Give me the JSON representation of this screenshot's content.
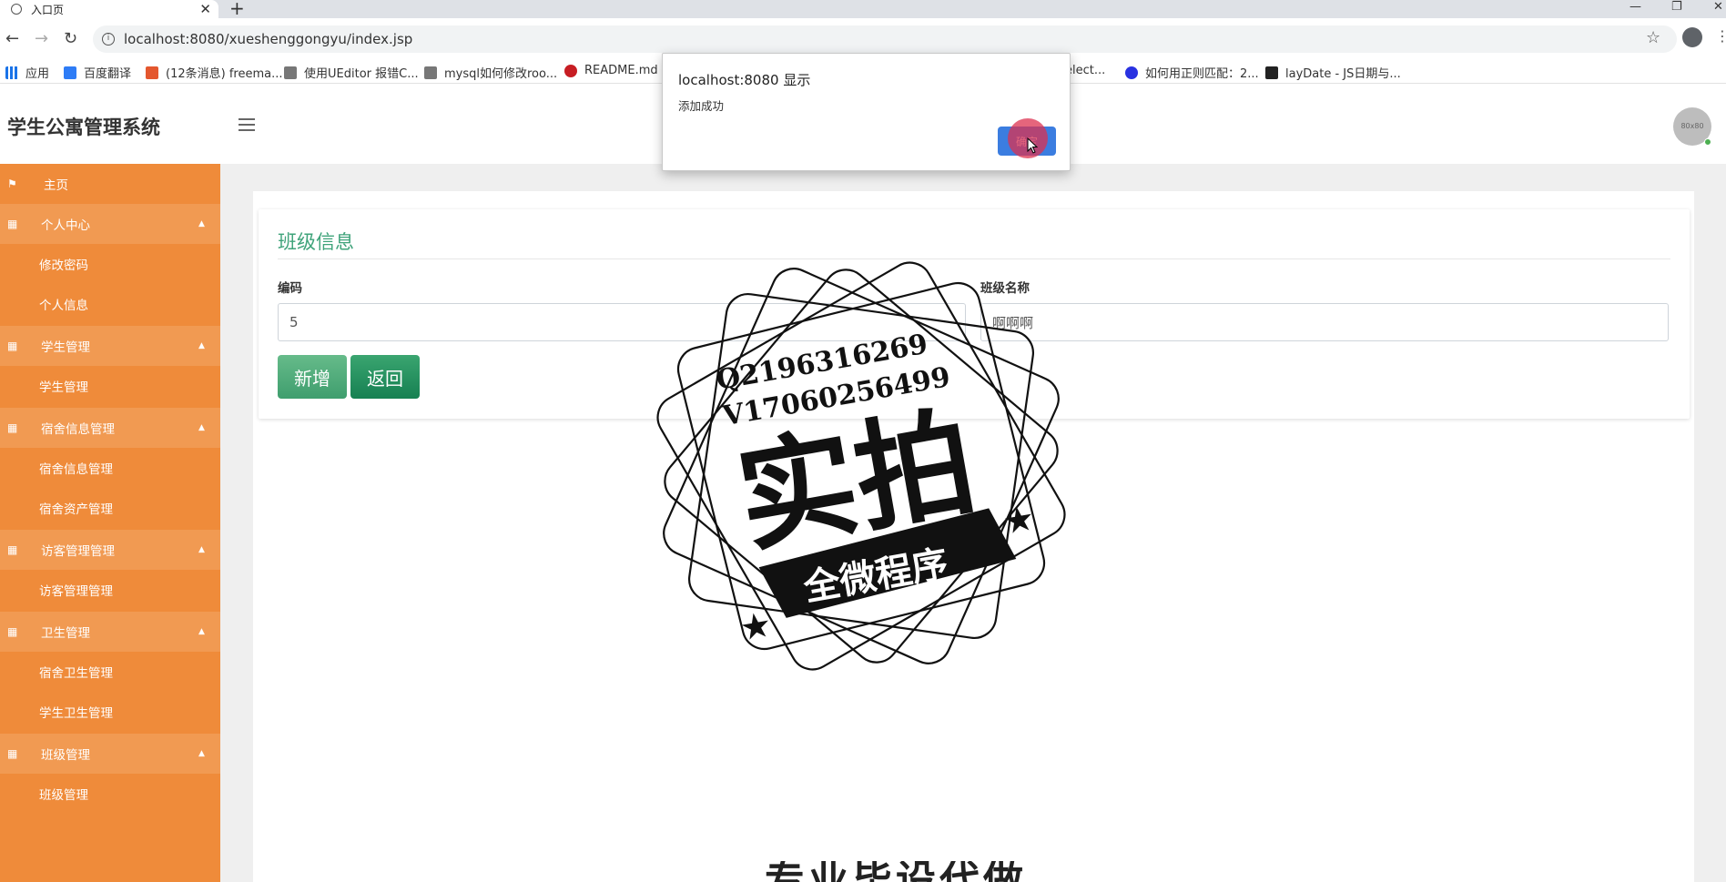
{
  "browser": {
    "tab_title": "入口页",
    "new_tab": "+",
    "url": "localhost:8080/xueshenggongyu/index.jsp",
    "bookmarks": [
      "应用",
      "百度翻译",
      "(12条消息) freema...",
      "使用UEditor 报错C...",
      "mysql如何修改roo...",
      "README.md ·",
      "elect...",
      "如何用正则匹配：2...",
      "layDate - JS日期与..."
    ]
  },
  "header": {
    "brand": "学生公寓管理系统",
    "avatar_text": "80x80"
  },
  "sidebar": {
    "items": [
      {
        "label": "主页",
        "type": "top"
      },
      {
        "label": "个人中心",
        "type": "group"
      },
      {
        "label": "修改密码",
        "type": "sub"
      },
      {
        "label": "个人信息",
        "type": "sub"
      },
      {
        "label": "学生管理",
        "type": "group"
      },
      {
        "label": "学生管理",
        "type": "sub"
      },
      {
        "label": "宿舍信息管理",
        "type": "group"
      },
      {
        "label": "宿舍信息管理",
        "type": "sub"
      },
      {
        "label": "宿舍资产管理",
        "type": "sub"
      },
      {
        "label": "访客管理管理",
        "type": "group"
      },
      {
        "label": "访客管理管理",
        "type": "sub"
      },
      {
        "label": "卫生管理",
        "type": "group"
      },
      {
        "label": "宿舍卫生管理",
        "type": "sub"
      },
      {
        "label": "学生卫生管理",
        "type": "sub"
      },
      {
        "label": "班级管理",
        "type": "group"
      },
      {
        "label": "班级管理",
        "type": "sub"
      }
    ]
  },
  "form": {
    "title": "班级信息",
    "code_label": "编码",
    "code_value": "5",
    "name_label": "班级名称",
    "name_value": "啊啊啊",
    "add_button": "新增",
    "back_button": "返回"
  },
  "dialog": {
    "title": "localhost:8080 显示",
    "message": "添加成功",
    "ok_label": "确定"
  },
  "watermark": {
    "line1": "Q2196316269",
    "line2": "V17060256499",
    "big": "实拍",
    "ribbon": "全微程序",
    "bottom": "专业毕设代做"
  }
}
